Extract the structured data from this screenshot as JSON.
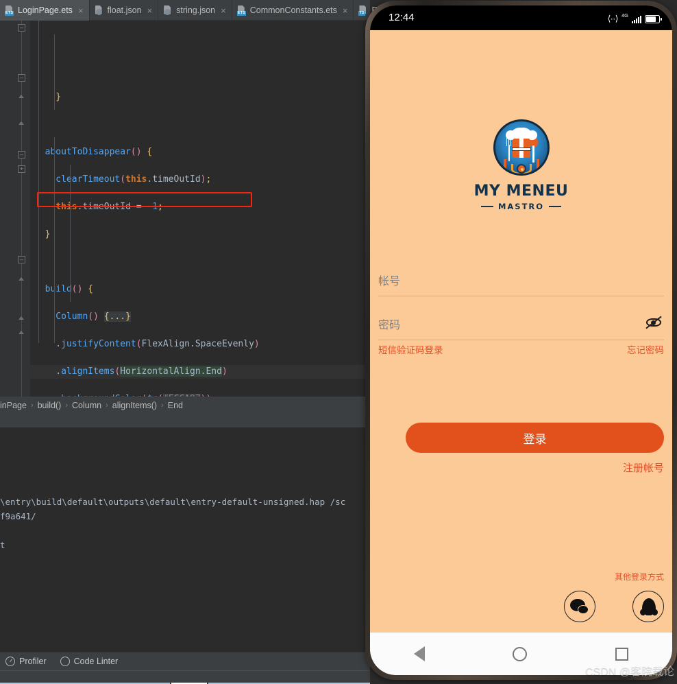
{
  "ide": {
    "tabs": [
      {
        "label": "LoginPage.ets",
        "icon": "ets-file-icon",
        "active": true,
        "kind": "ets"
      },
      {
        "label": "float.json",
        "icon": "json-file-icon",
        "active": false,
        "kind": "jsn"
      },
      {
        "label": "string.json",
        "icon": "json-file-icon",
        "active": false,
        "kind": "jsn"
      },
      {
        "label": "CommonConstants.ets",
        "icon": "ets-file-icon",
        "active": false,
        "kind": "ets"
      },
      {
        "label": "Ent",
        "icon": "ts-file-icon",
        "active": false,
        "kind": "ts"
      }
    ],
    "close_glyph": "×",
    "breadcrumb": [
      "inPage",
      "build()",
      "Column",
      "alignItems()",
      "End"
    ],
    "breadcrumb_sep": "›",
    "console_lines": [
      "\\entry\\build\\default\\outputs\\default\\entry-default-unsigned.hap /sc",
      "f9a641/",
      "",
      "t"
    ],
    "status_items": [
      {
        "label": "Profiler",
        "icon": "profiler-icon"
      },
      {
        "label": "Code Linter",
        "icon": "code-linter-icon"
      }
    ],
    "highlight_color": "#f22613"
  },
  "phone": {
    "status": {
      "time": "12:44",
      "arrows_icon": "data-transfer-icon",
      "network": "4G",
      "signal_icon": "signal-bars-icon",
      "battery_icon": "battery-icon"
    },
    "app": {
      "logo": {
        "icon": "chef-logo-icon",
        "title": "MY MENEU",
        "subtitle": "MASTRO"
      },
      "fields": [
        {
          "name": "account",
          "placeholder": "帐号",
          "value": ""
        },
        {
          "name": "password",
          "placeholder": "密码",
          "value": "",
          "trailing_icon": "eye-off-icon"
        }
      ],
      "links": {
        "sms_login": "短信验证码登录",
        "forgot_password": "忘记密码",
        "register": "注册帐号"
      },
      "login_button": "登录",
      "other_login_label": "其他登录方式",
      "social": [
        {
          "name": "wechat",
          "icon": "wechat-icon"
        },
        {
          "name": "qq",
          "icon": "qq-icon"
        }
      ],
      "accent_color": "#e2501b",
      "background_color": "#FCCA97"
    },
    "navbar": [
      {
        "name": "back",
        "icon": "triangle-back-icon"
      },
      {
        "name": "home",
        "icon": "circle-home-icon"
      },
      {
        "name": "recents",
        "icon": "square-recents-icon"
      }
    ]
  },
  "watermark": "CSDN @客院载论"
}
